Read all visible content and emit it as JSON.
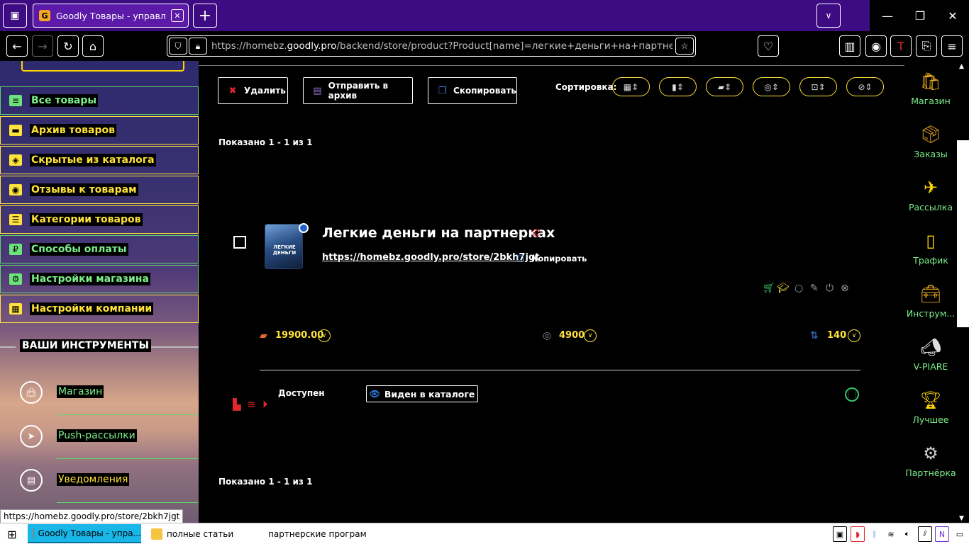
{
  "browser": {
    "tab_title": "Goodly Товары - управление",
    "tab_favicon": "G",
    "url_prefix": "https://homebz.",
    "url_domain": "goodly.pro",
    "url_path": "/backend/store/product?Product[name]=легкие+деньги+на+партнерках&Pro"
  },
  "sidebar": {
    "items": [
      {
        "label": "Все товары",
        "style": "green",
        "icon": "list-icon"
      },
      {
        "label": "Архив товаров",
        "style": "yellow",
        "icon": "archive-icon"
      },
      {
        "label": "Скрытые из каталога",
        "style": "yellow",
        "icon": "hidden-eye-icon"
      },
      {
        "label": "Отзывы к товарам",
        "style": "yellow",
        "icon": "comments-icon"
      },
      {
        "label": "Категории товаров",
        "style": "yellow",
        "icon": "categories-icon"
      },
      {
        "label": "Способы оплаты",
        "style": "green",
        "icon": "ruble-icon"
      },
      {
        "label": "Настройки магазина",
        "style": "green",
        "icon": "gear-icon"
      },
      {
        "label": "Настройки компании",
        "style": "yellow",
        "icon": "building-icon"
      }
    ],
    "tools_heading": "ВАШИ ИНСТРУМЕНТЫ",
    "tools": [
      {
        "label": "Магазин",
        "color": "#7cf08a",
        "icon": "shopping-bag-icon"
      },
      {
        "label": "Push-рассылки",
        "color": "#7cf08a",
        "icon": "telegram-icon"
      },
      {
        "label": "Уведомления",
        "color": "#ffe23a",
        "icon": "notifications-icon"
      }
    ]
  },
  "actions": {
    "delete_label": "Удалить",
    "archive_label": "Отправить в архив",
    "copy_label": "Скопировать",
    "sort_label": "Сортировка:"
  },
  "listing": {
    "shown_top": "Показано 1 - 1 из 1",
    "shown_bottom": "Показано 1 - 1 из 1"
  },
  "product": {
    "title": "Легкие деньги на партнерках",
    "copyright": "©",
    "thumb_text": "ЛЕГКИЕ ДЕНЬГИ",
    "link": "https://homebz.goodly.pro/store/2bkh7jgt",
    "copy_link_label": "Копировать",
    "price": "19900.00",
    "partner_amount": "4900",
    "sales_count": "140",
    "status": "Доступен",
    "catalog_label": "Виден в каталоге"
  },
  "rightbar": {
    "items": [
      {
        "label": "Магазин",
        "icon": "shop-bag-icon"
      },
      {
        "label": "Заказы",
        "icon": "orders-box-icon"
      },
      {
        "label": "Рассылка",
        "icon": "paper-plane-icon"
      },
      {
        "label": "Трафик",
        "icon": "mouse-icon"
      },
      {
        "label": "Инструм...",
        "icon": "toolbox-icon"
      },
      {
        "label": "V-PIARE",
        "icon": "megaphone-icon"
      },
      {
        "label": "Лучшее",
        "icon": "trophy-icon"
      },
      {
        "label": "Партнёрка",
        "icon": "partner-gear-icon"
      }
    ]
  },
  "status_url": "https://homebz.goodly.pro/store/2bkh7jgt",
  "taskbar": {
    "tasks": [
      {
        "label": "Goodly Товары - упра..."
      },
      {
        "label": "полные статьи"
      },
      {
        "label": "партнерские програм..."
      }
    ]
  },
  "colors": {
    "tab_bg": "#3d0b82",
    "accent_yellow": "#ffe23a",
    "accent_green": "#7cf08a",
    "danger_red": "#e0282e"
  }
}
